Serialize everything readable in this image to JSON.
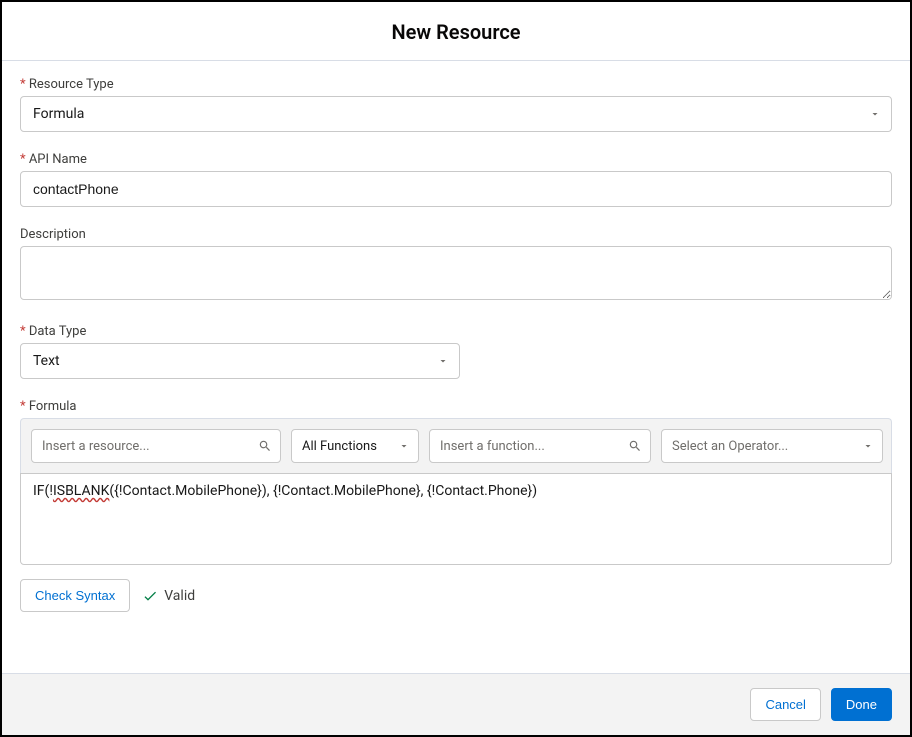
{
  "header": {
    "title": "New Resource"
  },
  "fields": {
    "resourceType": {
      "label": "Resource Type",
      "value": "Formula"
    },
    "apiName": {
      "label": "API Name",
      "value": "contactPhone"
    },
    "description": {
      "label": "Description",
      "value": ""
    },
    "dataType": {
      "label": "Data Type",
      "value": "Text"
    },
    "formula": {
      "label": "Formula",
      "toolbar": {
        "resourcePlaceholder": "Insert a resource...",
        "functionCategory": "All Functions",
        "functionPlaceholder": "Insert a function...",
        "operatorPlaceholder": "Select an Operator..."
      },
      "expression_prefix": "IF(!",
      "expression_squiggly": "ISBLANK",
      "expression_suffix": "({!Contact.MobilePhone}), {!Contact.MobilePhone}, {!Contact.Phone})"
    }
  },
  "syntax": {
    "checkLabel": "Check Syntax",
    "status": "Valid"
  },
  "footer": {
    "cancel": "Cancel",
    "done": "Done"
  }
}
